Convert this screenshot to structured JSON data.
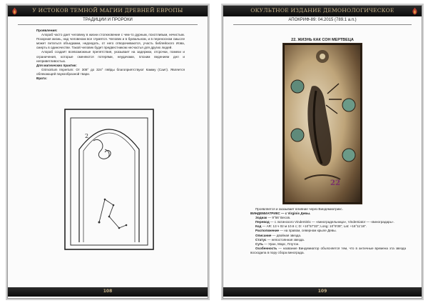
{
  "left_page": {
    "header": "У ИСТОКОВ ТЕМНОЙ МАГИИ ДРЕВНЕЙ ЕВРОПЫ",
    "section": "ТРАДИЦИИ И ПРОРОКИ",
    "heading_manifest": "Проявления:",
    "para1": "Алораб часто дает человеку в жизни столкновение с чем-то дурным, похотливым, нечистым. Позорная жизнь, над человеком все глумятся. Человек и в буквальном, и в переносном смысле может питаться объедками, недоедать, от него отворачиваются, участь библейского Иова, смерть в одиночестве. Такой человек будет предвестником несчастья для других людей.",
    "para2": "Алораб создаёт всевозможные препятствия, указывает на задержки, отсрочки, помехи и ограничения, которые сменяются потерями, неудачами, плохим ведением дел и неприветливостью.",
    "heading_practice": "Для магических практик:",
    "para3": "Grimoirium Imperium: От 308° до 324° пяйды благоприятствуют Камму (Саит). Является облекающей паукообразной твари.",
    "heading_gates": "Врата:",
    "page_number": "108"
  },
  "right_page": {
    "header": "ОКУЛЬТНОЕ ИЗДАНИЕ ДЕМОНОЛОГИЧЕСКОЕ",
    "section": "АПОКРИФ-89: 04.2015 (789.1 а.п.)",
    "title": "22. ЖИЗНЬ КАК СОН МЕРТВЕЦА",
    "card_number": "22",
    "intro": "Проявляется и оказывает влияние через Виндемиатрикс.",
    "star_name": "ВИНДЕМИАТРИКС — ε Virginis Девы.",
    "lines": [
      {
        "label": "Зодиак",
        "value": " — 9°56' Весов."
      },
      {
        "label": "Перевод",
        "value": " — с латинского Vindemitrix — «виноградельница», Vindemiator — «виноградарь»."
      },
      {
        "label": "Код",
        "value": " — AR: 13 ч 02 м 10.6 с; D: +10°57'33\"; Long: 10°9'35\"; Lat: +16°11'18\"."
      },
      {
        "label": "Расположение",
        "value": " — на правом, северном крыле Девы."
      },
      {
        "label": "Описание",
        "value": " — двойная звезда."
      },
      {
        "label": "Статус",
        "value": " — непостоянная звезда."
      },
      {
        "label": "Суть",
        "value": " — Уран, Марс, Плутон."
      },
      {
        "label": "Особенность",
        "value": " — название Виндемиатор объясняется тем, что в античные времена эта звезда восходила в пору сбора винограда."
      }
    ],
    "page_number": "109"
  },
  "colors": {
    "bar": "#111111",
    "bar_text": "#c9b48a",
    "page_bg": "#fbfbfb"
  }
}
